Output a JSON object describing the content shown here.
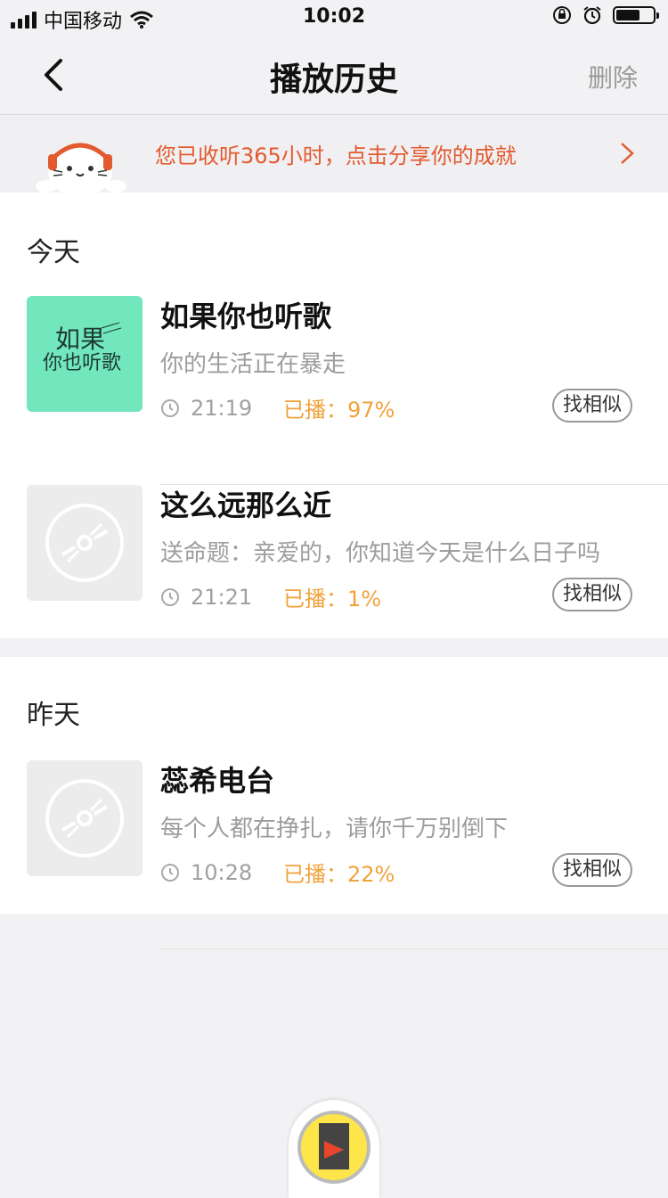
{
  "status_bar": {
    "carrier": "中国移动",
    "time": "10:02"
  },
  "nav": {
    "title": "播放历史",
    "delete_label": "删除"
  },
  "banner": {
    "text": "您已收听365小时，点击分享你的成就"
  },
  "sections": [
    {
      "title": "今天",
      "items": [
        {
          "name": "如果你也听歌",
          "desc": "你的生活正在暴走",
          "duration": "21:19",
          "played": "已播：97%",
          "similar_label": "找相似",
          "cover_text_line1": "如果",
          "cover_text_line2": "你也听歌"
        },
        {
          "name": "这么远那么近",
          "desc": "送命题：亲爱的，你知道今天是什么日子吗",
          "duration": "21:21",
          "played": "已播：1%",
          "similar_label": "找相似"
        }
      ]
    },
    {
      "title": "昨天",
      "items": [
        {
          "name": "蕊希电台",
          "desc": "每个人都在挣扎，请你千万别倒下",
          "duration": "10:28",
          "played": "已播：22%",
          "similar_label": "找相似"
        }
      ]
    }
  ],
  "colors": {
    "accent_orange": "#e35a2f",
    "played_yellow": "#f1a23b",
    "cover_green": "#72e7bd"
  }
}
